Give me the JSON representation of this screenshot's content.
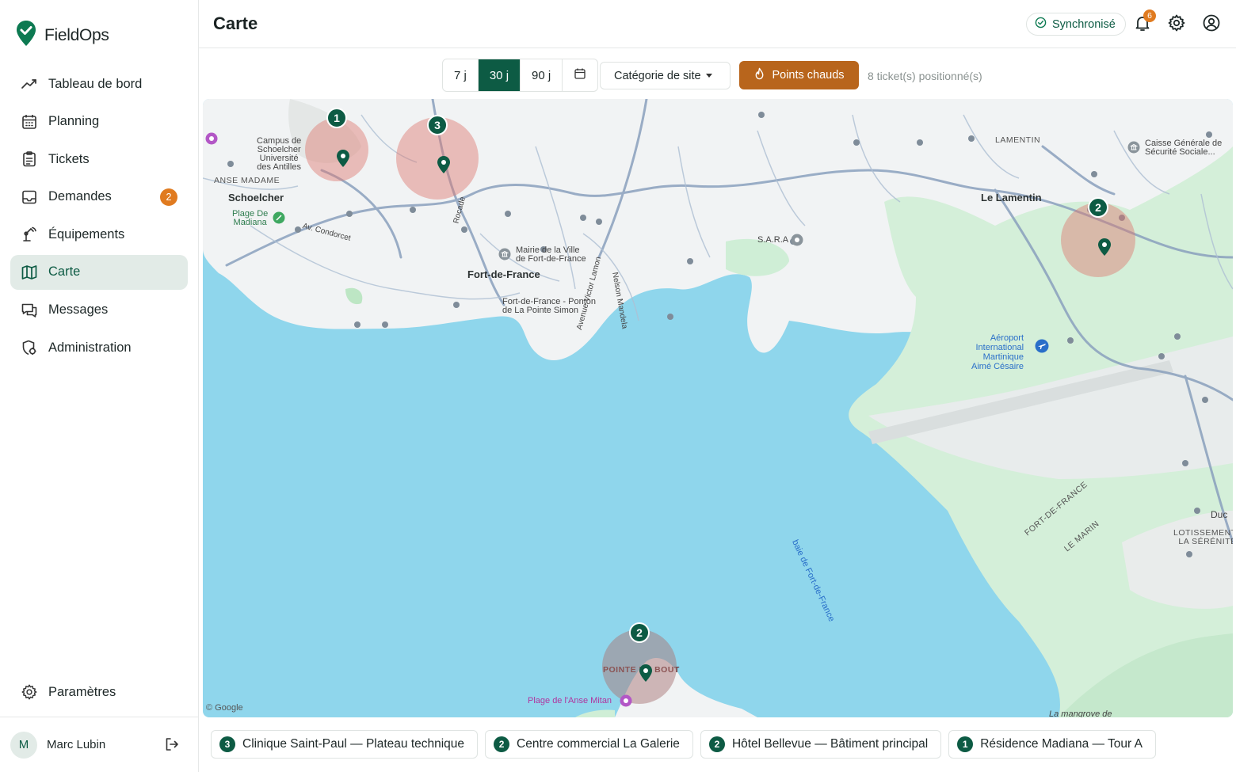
{
  "app": {
    "name": "FieldOps"
  },
  "sidebar": {
    "items": [
      {
        "label": "Tableau de bord",
        "icon": "dashboard-trend-icon"
      },
      {
        "label": "Planning",
        "icon": "calendar-icon"
      },
      {
        "label": "Tickets",
        "icon": "clipboard-icon"
      },
      {
        "label": "Demandes",
        "icon": "inbox-icon",
        "badge": "2"
      },
      {
        "label": "Équipements",
        "icon": "equipment-icon"
      },
      {
        "label": "Carte",
        "icon": "map-icon",
        "active": true
      },
      {
        "label": "Messages",
        "icon": "chat-icon"
      },
      {
        "label": "Administration",
        "icon": "admin-icon"
      }
    ],
    "settings_label": "Paramètres",
    "user": {
      "initial": "M",
      "name": "Marc Lubin"
    }
  },
  "header": {
    "title": "Carte",
    "sync_label": "Synchronisé",
    "notification_count": "6"
  },
  "toolbar": {
    "periods": [
      "7 j",
      "30 j",
      "90 j"
    ],
    "active_period": "30 j",
    "category_label": "Catégorie de site",
    "hotspots_label": "Points chauds",
    "ticket_count_text": "8 ticket(s) positionné(s)"
  },
  "map": {
    "attribution": "© Google",
    "labels": {
      "schoelcher": "Schoelcher",
      "anse_madame": "ANSE MADAME",
      "campus": "Campus de\nSchoelcher\nUniversité\ndes Antilles",
      "plage_madiana": "Plage De\nMadiana",
      "fdf": "Fort-de-France",
      "mairie": "Mairie de la Ville\nde Fort-de-France",
      "ponton": "Fort-de-France - Ponton\nde La Pointe Simon",
      "sara": "S.A.R.A",
      "lamentin_caps": "LAMENTIN",
      "le_lamentin": "Le Lamentin",
      "caisse": "Caisse Générale de\nSécurité Sociale...",
      "aeroport": "Aéroport\nInternational\nMartinique\nAimé Césaire",
      "baie": "baie de Fort-de-France",
      "pointe_bout": "POINTE DU BOUT",
      "plage_mitan": "Plage de l'Anse Mitan",
      "fdf_road": "FORT-DE-FRANCE",
      "le_marin": "LE MARIN",
      "lotissement": "LOTISSEMENT\nLA SÉRÉNITÉ",
      "duc": "Duc",
      "mangrove": "La mangrove de",
      "av_condorcet": "Av. Condorcet",
      "rocade": "Rocade",
      "nelson": "Nelson Mandela",
      "victor": "Avenue Victor Lamon"
    },
    "clusters": [
      {
        "count": "1",
        "site": "Résidence Madiana — Tour A"
      },
      {
        "count": "3",
        "site": "Clinique Saint-Paul — Plateau technique"
      },
      {
        "count": "2",
        "site": "Hôtel Bellevue — Bâtiment principal"
      },
      {
        "count": "2",
        "site": "Centre commercial La Galerie"
      }
    ]
  },
  "legend": [
    {
      "count": "3",
      "label": "Clinique Saint-Paul — Plateau technique"
    },
    {
      "count": "2",
      "label": "Centre commercial La Galerie"
    },
    {
      "count": "2",
      "label": "Hôtel Bellevue — Bâtiment principal"
    },
    {
      "count": "1",
      "label": "Résidence Madiana — Tour A"
    }
  ],
  "colors": {
    "brand": "#0d5b44",
    "accent": "#e07b20",
    "hotspot_button": "#b8651c",
    "water": "#8fd6ec",
    "land": "#f1f3f4",
    "vegetation": "#cdeed3"
  }
}
